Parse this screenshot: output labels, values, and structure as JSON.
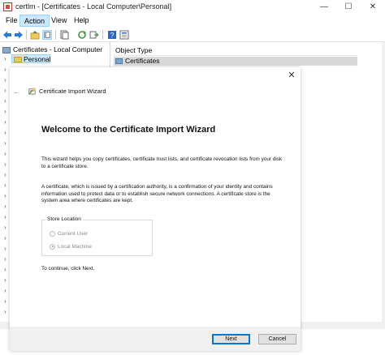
{
  "window": {
    "title": "certlm - [Certificates - Local Computer\\Personal]",
    "controls": {
      "minimize": "—",
      "maximize": "☐",
      "close": "✕"
    }
  },
  "menu": {
    "items": [
      "File",
      "Action",
      "View",
      "Help"
    ],
    "active": "Action"
  },
  "tree": {
    "root": "Certificates - Local Computer",
    "selected": "Personal"
  },
  "list": {
    "column_header": "Object Type",
    "row": "Certificates"
  },
  "wizard": {
    "close_glyph": "✕",
    "back_glyph": "←",
    "title": "Certificate Import Wizard",
    "heading": "Welcome to the Certificate Import Wizard",
    "paragraph1": "This wizard helps you copy certificates, certificate trust lists, and certificate revocation lists from your disk to a certificate store.",
    "paragraph2": "A certificate, which is issued by a certification authority, is a confirmation of your identity and contains information used to protect data or to establish secure network connections. A certificate store is the system area where certificates are kept.",
    "store_location": {
      "label": "Store Location",
      "options": [
        {
          "label": "Current User",
          "checked": false
        },
        {
          "label": "Local Machine",
          "checked": true
        }
      ]
    },
    "continue_text": "To continue, click Next.",
    "next_label": "Next",
    "cancel_label": "Cancel"
  },
  "colors": {
    "accent": "#0078d7",
    "selection": "#cce8ff",
    "footer": "#f0f0f0"
  }
}
